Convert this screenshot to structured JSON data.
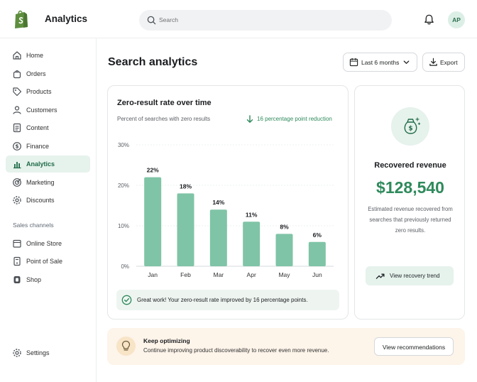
{
  "app": {
    "title": "Analytics",
    "avatar_initials": "AP"
  },
  "search": {
    "placeholder": "Search"
  },
  "sidebar": {
    "items": [
      {
        "label": "Home",
        "icon": "home-icon"
      },
      {
        "label": "Orders",
        "icon": "bag-icon"
      },
      {
        "label": "Products",
        "icon": "tag-icon"
      },
      {
        "label": "Customers",
        "icon": "person-icon"
      },
      {
        "label": "Content",
        "icon": "document-icon"
      },
      {
        "label": "Finance",
        "icon": "dollar-circle-icon"
      },
      {
        "label": "Analytics",
        "icon": "bar-chart-icon",
        "active": true
      },
      {
        "label": "Marketing",
        "icon": "target-icon"
      },
      {
        "label": "Discounts",
        "icon": "gear-icon"
      }
    ],
    "section_label": "Sales channels",
    "channels": [
      {
        "label": "Online Store",
        "icon": "store-icon"
      },
      {
        "label": "Point of Sale",
        "icon": "pos-icon"
      },
      {
        "label": "Shop",
        "icon": "shop-icon"
      }
    ],
    "settings_label": "Settings"
  },
  "header": {
    "title": "Search analytics",
    "date_range": "Last 6 months",
    "export_label": "Export"
  },
  "chart_card": {
    "title": "Zero-result rate over time",
    "subtitle": "Percent of searches with zero results",
    "reduction_label": "16 percentage point reduction",
    "success_message": "Great work! Your zero-result rate improved by 16 percentage points."
  },
  "chart_data": {
    "type": "bar",
    "title": "Zero-result rate over time",
    "categories": [
      "Jan",
      "Feb",
      "Mar",
      "Apr",
      "May",
      "Jun"
    ],
    "values": [
      22,
      18,
      14,
      11,
      8,
      6
    ],
    "value_labels": [
      "22%",
      "18%",
      "14%",
      "11%",
      "8%",
      "6%"
    ],
    "y_ticks": [
      "0%",
      "10%",
      "20%",
      "30%"
    ],
    "ylim": [
      0,
      30
    ],
    "grid": true,
    "bar_color": "#7fc4a6"
  },
  "revenue_card": {
    "title": "Recovered revenue",
    "value": "$128,540",
    "description": "Estimated revenue recovered from searches that previously returned zero results.",
    "trend_button": "View recovery trend"
  },
  "tip": {
    "title": "Keep optimizing",
    "text": "Continue improving product discoverability to recover even more revenue.",
    "button": "View recommendations"
  },
  "colors": {
    "accent": "#2f8a5c",
    "accent_light": "#e6f2ec",
    "bar": "#7fc4a6",
    "tip_bg": "#fdf4ea"
  }
}
